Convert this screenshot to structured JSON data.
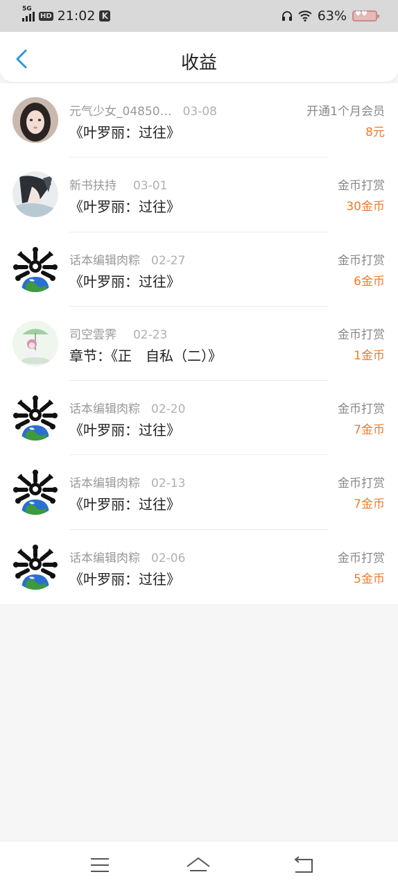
{
  "status_bar": {
    "network": "5G",
    "hd": "HD",
    "time": "21:02",
    "app_badge": "K",
    "battery": "63%"
  },
  "header": {
    "title": "收益"
  },
  "items": [
    {
      "name": "元气少女_04850…",
      "date": "03-08",
      "book": "《叶罗丽：过往》",
      "type": "开通1个月会员",
      "amount": "8元",
      "avatar": "girl-photo"
    },
    {
      "name": "新书扶持",
      "date": "03-01",
      "book": "《叶罗丽：过往》",
      "type": "金币打赏",
      "amount": "30金币",
      "avatar": "anime-character"
    },
    {
      "name": "话本编辑肉粽",
      "date": "02-27",
      "book": "《叶罗丽：过往》",
      "type": "金币打赏",
      "amount": "6金币",
      "avatar": "earth-bones"
    },
    {
      "name": "司空雲霁",
      "date": "02-23",
      "book": "章节：《正　自私（二）》",
      "type": "金币打赏",
      "amount": "1金币",
      "avatar": "umbrella-girl"
    },
    {
      "name": "话本编辑肉粽",
      "date": "02-20",
      "book": "《叶罗丽：过往》",
      "type": "金币打赏",
      "amount": "7金币",
      "avatar": "earth-bones"
    },
    {
      "name": "话本编辑肉粽",
      "date": "02-13",
      "book": "《叶罗丽：过往》",
      "type": "金币打赏",
      "amount": "7金币",
      "avatar": "earth-bones"
    },
    {
      "name": "话本编辑肉粽",
      "date": "02-06",
      "book": "《叶罗丽：过往》",
      "type": "金币打赏",
      "amount": "5金币",
      "avatar": "earth-bones"
    }
  ],
  "colors": {
    "accent": "#2b97d9",
    "amount": "#ef7b2a"
  },
  "nav": {
    "menu_icon": "menu-icon",
    "home_icon": "home-icon",
    "back_icon": "back-icon"
  }
}
